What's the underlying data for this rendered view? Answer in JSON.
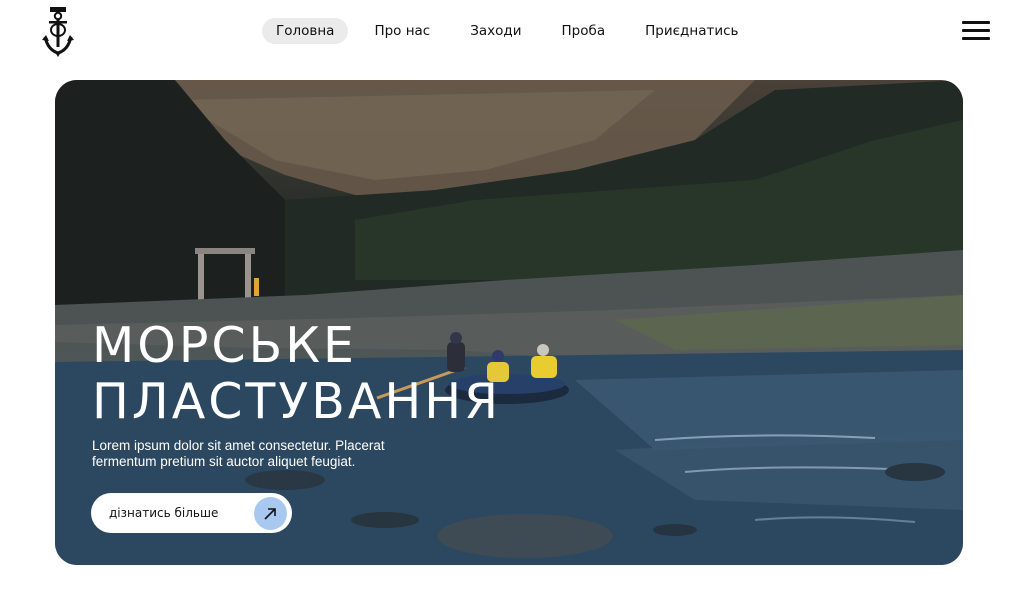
{
  "nav": {
    "items": [
      {
        "label": "Головна",
        "active": true
      },
      {
        "label": "Про нас",
        "active": false
      },
      {
        "label": "Заходи",
        "active": false
      },
      {
        "label": "Проба",
        "active": false
      },
      {
        "label": "Приєднатись",
        "active": false
      }
    ]
  },
  "icons": {
    "logo": "anchor-icon",
    "menu": "hamburger-menu-icon",
    "cta": "arrow-up-right-icon"
  },
  "hero": {
    "title_line1": "МОРСЬКЕ",
    "title_line2": "ПЛАСТУВАННЯ",
    "description": "Lorem ipsum dolor sit amet consectetur. Placerat fermentum pretium sit auctor aliquet feugiat.",
    "cta_label": "дізнатись більше"
  },
  "colors": {
    "nav_active_bg": "#ebebeb",
    "cta_arrow_bg": "#a8c8f0",
    "text_dark": "#111111",
    "hero_text": "#ffffff"
  }
}
